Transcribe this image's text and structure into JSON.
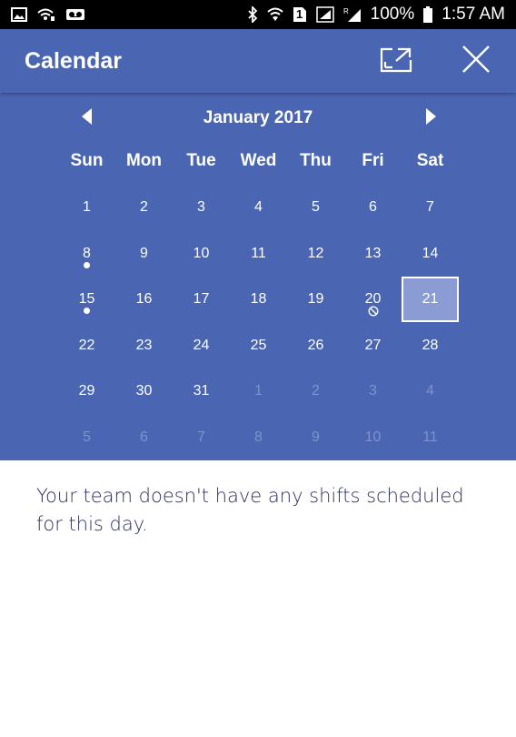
{
  "status_bar": {
    "battery_percent": "100%",
    "time": "1:57 AM",
    "sim_label": "1",
    "icons": [
      "image-icon",
      "wifi-calling-icon",
      "voicemail-icon",
      "bluetooth-icon",
      "wifi-icon",
      "sim-icon",
      "signal-icon",
      "roaming-signal-icon",
      "battery-icon"
    ]
  },
  "header": {
    "title": "Calendar",
    "icons": [
      "expand-icon",
      "close-icon"
    ]
  },
  "calendar": {
    "month_label": "January 2017",
    "weekdays": [
      "Sun",
      "Mon",
      "Tue",
      "Wed",
      "Thu",
      "Fri",
      "Sat"
    ],
    "days": [
      {
        "label": "1"
      },
      {
        "label": "2"
      },
      {
        "label": "3"
      },
      {
        "label": "4"
      },
      {
        "label": "5"
      },
      {
        "label": "6"
      },
      {
        "label": "7"
      },
      {
        "label": "8",
        "marker": "dot"
      },
      {
        "label": "9"
      },
      {
        "label": "10"
      },
      {
        "label": "11"
      },
      {
        "label": "12"
      },
      {
        "label": "13"
      },
      {
        "label": "14"
      },
      {
        "label": "15",
        "marker": "dot"
      },
      {
        "label": "16"
      },
      {
        "label": "17"
      },
      {
        "label": "18"
      },
      {
        "label": "19"
      },
      {
        "label": "20",
        "marker": "ban"
      },
      {
        "label": "21",
        "selected": true
      },
      {
        "label": "22"
      },
      {
        "label": "23"
      },
      {
        "label": "24"
      },
      {
        "label": "25"
      },
      {
        "label": "26"
      },
      {
        "label": "27"
      },
      {
        "label": "28"
      },
      {
        "label": "29"
      },
      {
        "label": "30"
      },
      {
        "label": "31"
      },
      {
        "label": "1",
        "muted": true
      },
      {
        "label": "2",
        "muted": true
      },
      {
        "label": "3",
        "muted": true
      },
      {
        "label": "4",
        "muted": true
      },
      {
        "label": "5",
        "muted": true
      },
      {
        "label": "6",
        "muted": true
      },
      {
        "label": "7",
        "muted": true
      },
      {
        "label": "8",
        "muted": true
      },
      {
        "label": "9",
        "muted": true
      },
      {
        "label": "10",
        "muted": true
      },
      {
        "label": "11",
        "muted": true
      }
    ]
  },
  "message": "Your team doesn't have any shifts scheduled for this day.",
  "colors": {
    "primary": "#4a66b3",
    "selected_day": "#8b9cd4",
    "muted_day": "#7f92cc",
    "message_text": "#2b2f5a"
  }
}
